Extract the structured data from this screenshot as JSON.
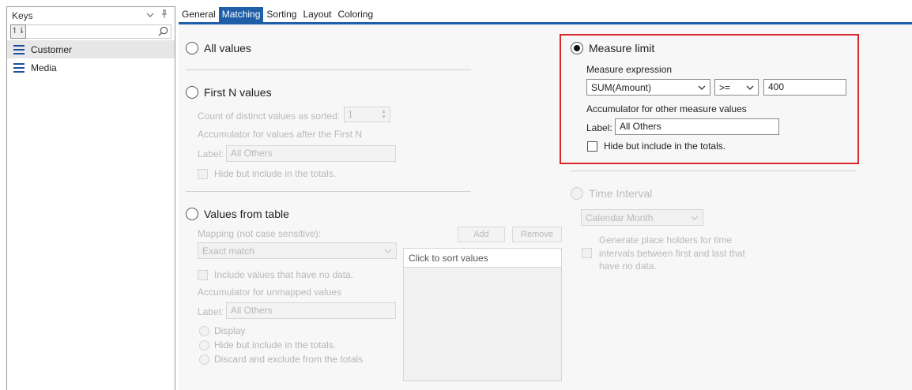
{
  "keys_pane": {
    "title": "Keys",
    "dropdown_icon": "chevron-down-icon",
    "pin_icon": "pin-icon",
    "sort_button_label": "↿⇂",
    "search_value": "",
    "items": [
      {
        "label": "Customer",
        "selected": true
      },
      {
        "label": "Media",
        "selected": false
      }
    ]
  },
  "tabs": [
    {
      "label": "General",
      "active": false
    },
    {
      "label": "Matching",
      "active": true
    },
    {
      "label": "Sorting",
      "active": false
    },
    {
      "label": "Layout",
      "active": false
    },
    {
      "label": "Coloring",
      "active": false
    }
  ],
  "all_values": {
    "label": "All values",
    "checked": false
  },
  "first_n": {
    "label": "First N values",
    "count_label": "Count of distinct values as sorted:",
    "count_value": "1",
    "accumulator_label": "Accumulator for values after the First N",
    "label_label": "Label:",
    "label_value": "All Others",
    "hide_label": "Hide but include in the totals."
  },
  "values_from_table": {
    "label": "Values from table",
    "mapping_label": "Mapping (not case sensitive):",
    "mapping_value": "Exact match",
    "add_label": "Add",
    "remove_label": "Remove",
    "list_header": "Click to sort values",
    "include_label": "Include values that have no data.",
    "accumulator_label": "Accumulator for unmapped values",
    "label_label": "Label:",
    "label_value": "All Others",
    "options": [
      "Display",
      "Hide but include in the totals.",
      "Discard and exclude from the totals"
    ]
  },
  "measure_limit": {
    "label": "Measure limit",
    "checked": true,
    "expression_label": "Measure expression",
    "expression_value": "SUM(Amount)",
    "operator_value": ">=",
    "threshold_value": "400",
    "accumulator_label": "Accumulator for other measure values",
    "label_label": "Label:",
    "label_value": "All Others",
    "hide_label": "Hide but include in the totals."
  },
  "time_interval": {
    "label": "Time Interval",
    "interval_value": "Calendar Month",
    "generate_label_1": "Generate place holders for time",
    "generate_label_2": "intervals between first and last that",
    "generate_label_3": "have no data."
  },
  "colors": {
    "accent": "#1f5fa8",
    "highlight": "#d9272e",
    "icon": "#1e4f9c"
  }
}
